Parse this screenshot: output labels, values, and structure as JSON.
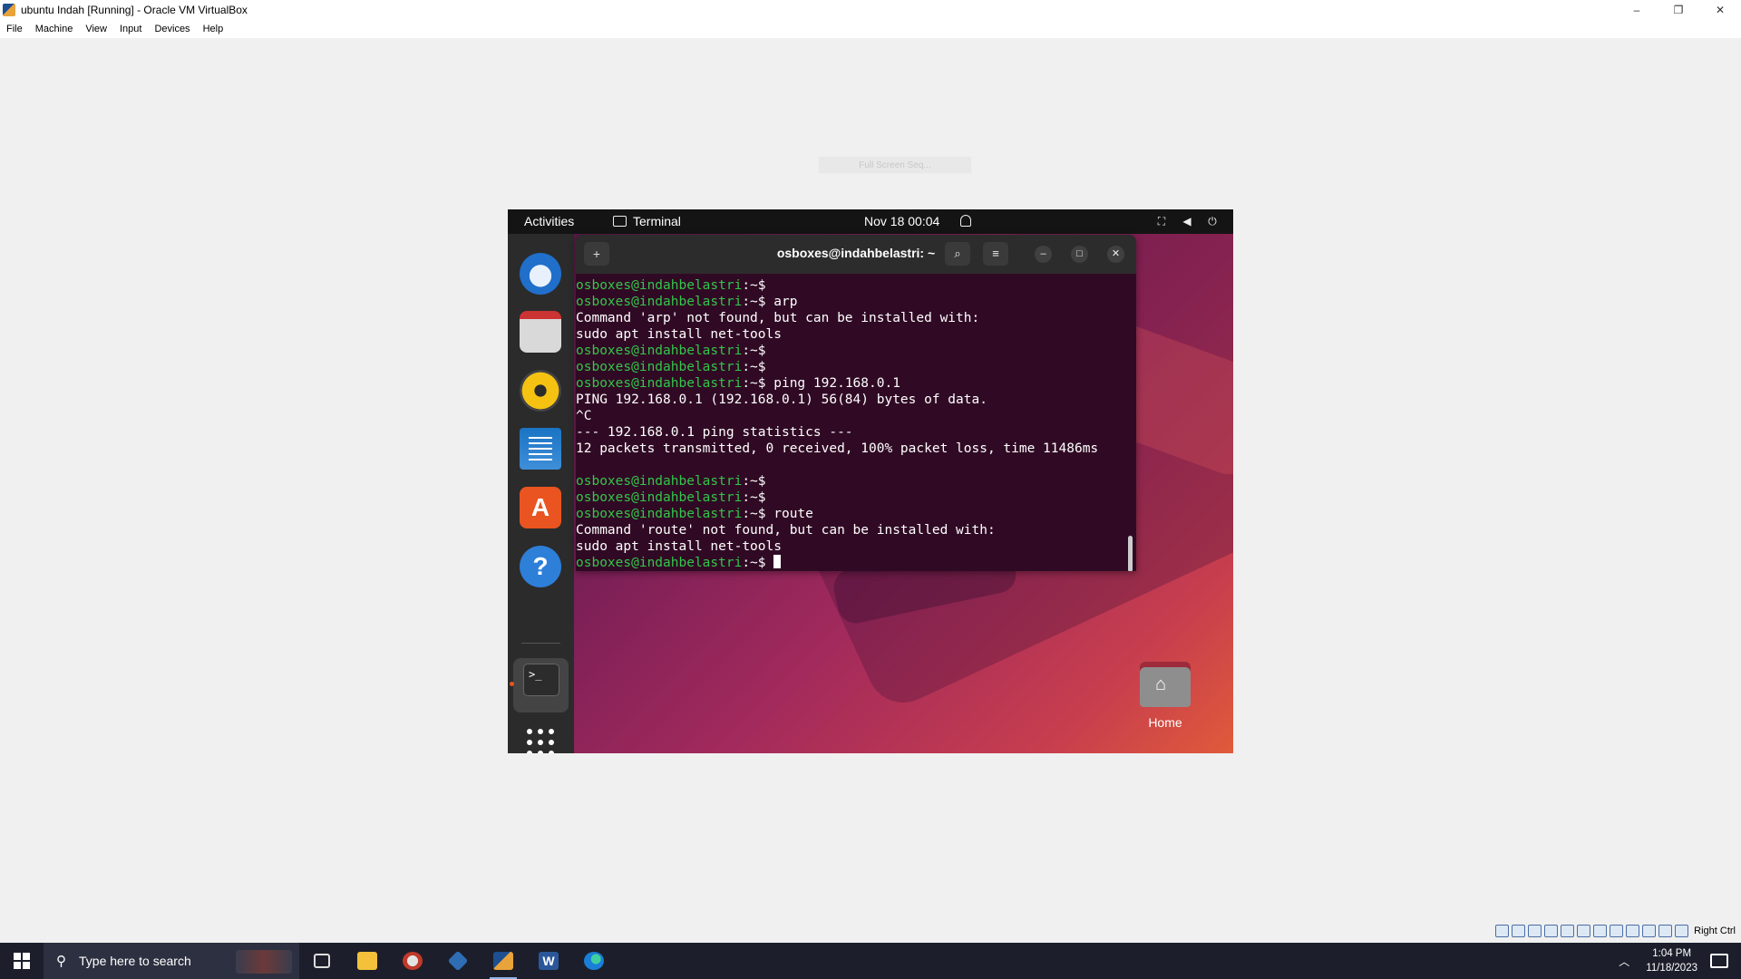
{
  "window": {
    "title": "ubuntu Indah [Running] - Oracle VM VirtualBox",
    "controls": {
      "minimize": "–",
      "restore": "❐",
      "close": "✕"
    }
  },
  "menubar": [
    "File",
    "Machine",
    "View",
    "Input",
    "Devices",
    "Help"
  ],
  "vm": {
    "fullscreen_hint": "Full Screen Seq..."
  },
  "gnome_topbar": {
    "activities": "Activities",
    "app_name": "Terminal",
    "clock": "Nov 18  00:04",
    "tray_icons": [
      "network-icon",
      "volume-icon",
      "power-icon"
    ]
  },
  "dock": {
    "items": [
      "thunderbird-icon",
      "files-icon",
      "rhythmbox-icon",
      "libreoffice-writer-icon",
      "ubuntu-software-icon",
      "help-icon",
      "terminal-icon",
      "show-apps-icon"
    ],
    "terminal_glyph": ">_"
  },
  "desktop": {
    "home_label": "Home"
  },
  "terminal": {
    "title": "osboxes@indahbelastri: ~",
    "prompt_user": "osboxes@indahbelastri",
    "lines": [
      {
        "type": "prompt",
        "cmd": ""
      },
      {
        "type": "prompt",
        "cmd": " arp"
      },
      {
        "type": "out",
        "text": "Command 'arp' not found, but can be installed with:"
      },
      {
        "type": "out",
        "text": "sudo apt install net-tools"
      },
      {
        "type": "prompt",
        "cmd": ""
      },
      {
        "type": "prompt",
        "cmd": ""
      },
      {
        "type": "prompt",
        "cmd": " ping 192.168.0.1"
      },
      {
        "type": "out",
        "text": "PING 192.168.0.1 (192.168.0.1) 56(84) bytes of data."
      },
      {
        "type": "out",
        "text": "^C"
      },
      {
        "type": "out",
        "text": "--- 192.168.0.1 ping statistics ---"
      },
      {
        "type": "out",
        "text": "12 packets transmitted, 0 received, 100% packet loss, time 11486ms"
      },
      {
        "type": "out",
        "text": ""
      },
      {
        "type": "prompt",
        "cmd": ""
      },
      {
        "type": "prompt",
        "cmd": ""
      },
      {
        "type": "prompt",
        "cmd": " route"
      },
      {
        "type": "out",
        "text": "Command 'route' not found, but can be installed with:"
      },
      {
        "type": "out",
        "text": "sudo apt install net-tools"
      },
      {
        "type": "prompt",
        "cmd": " ",
        "cursor": true
      }
    ]
  },
  "vbox_status": {
    "host_key": "Right Ctrl"
  },
  "taskbar": {
    "search_placeholder": "Type here to search",
    "apps": [
      "task-view-icon",
      "file-explorer-icon",
      "browser-icon",
      "virtualbox-icon",
      "virtualbox-vm-icon",
      "word-icon",
      "edge-icon"
    ],
    "word_glyph": "W",
    "time": "1:04 PM",
    "date": "11/18/2023"
  }
}
